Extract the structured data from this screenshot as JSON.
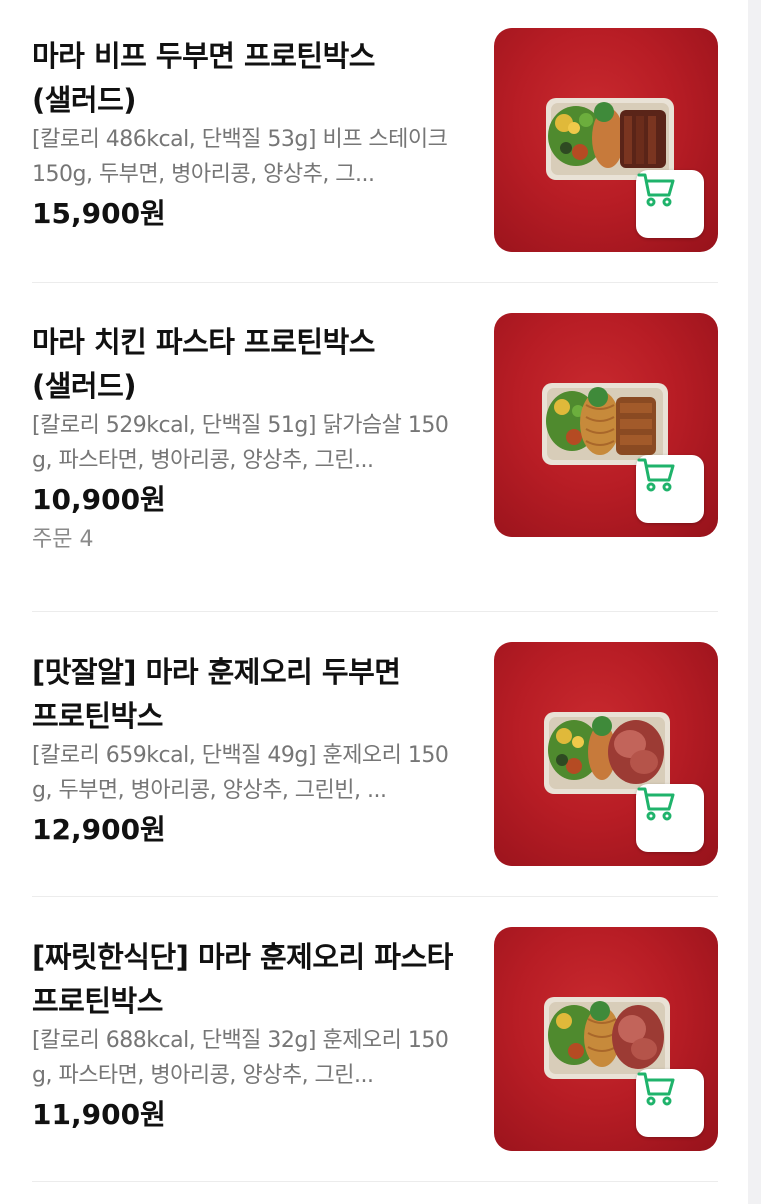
{
  "colors": {
    "thumb_red": "#b81d25",
    "cart_icon_green": "#1fb36b",
    "desc_gray": "#767676"
  },
  "items": [
    {
      "name": "마라 비프 두부면 프로틴박스 (샐러드)",
      "description": "[칼로리 486kcal, 단백질 53g] 비프 스테이크 150g, 두부면, 병아리콩, 양상추, 그...",
      "price": "15,900원",
      "orders": "",
      "cart_icon": "shopping-cart-icon"
    },
    {
      "name": "마라 치킨 파스타 프로틴박스 (샐러드)",
      "description": "[칼로리 529kcal, 단백질 51g] 닭가슴살 150g, 파스타면, 병아리콩, 양상추, 그린...",
      "price": "10,900원",
      "orders": "주문 4",
      "cart_icon": "shopping-cart-icon"
    },
    {
      "name": "[맛잘알] 마라 훈제오리 두부면 프로틴박스",
      "description": "[칼로리 659kcal, 단백질 49g] 훈제오리 150g, 두부면, 병아리콩, 양상추, 그린빈, ...",
      "price": "12,900원",
      "orders": "",
      "cart_icon": "shopping-cart-icon"
    },
    {
      "name": "[짜릿한식단] 마라 훈제오리 파스타 프로틴박스",
      "description": "[칼로리 688kcal, 단백질 32g] 훈제오리 150g, 파스타면, 병아리콩, 양상추, 그린...",
      "price": "11,900원",
      "orders": "",
      "cart_icon": "shopping-cart-icon"
    }
  ]
}
